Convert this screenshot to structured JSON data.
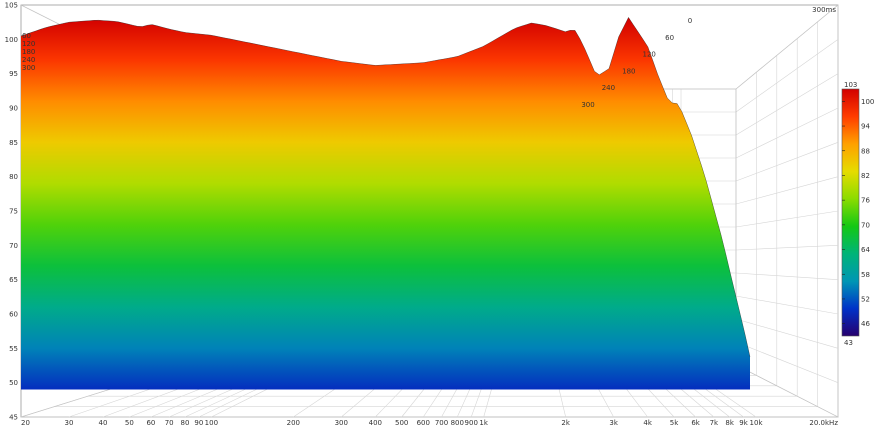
{
  "chart_data": {
    "type": "waterfall",
    "window_label": "300ms",
    "x_axis": {
      "scale": "log",
      "range": [
        20,
        20000
      ],
      "ticks": [
        {
          "v": 20,
          "label": "20"
        },
        {
          "v": 30,
          "label": "30"
        },
        {
          "v": 40,
          "label": "40"
        },
        {
          "v": 50,
          "label": "50"
        },
        {
          "v": 60,
          "label": "60"
        },
        {
          "v": 70,
          "label": "70"
        },
        {
          "v": 80,
          "label": "80"
        },
        {
          "v": 90,
          "label": "90"
        },
        {
          "v": 100,
          "label": "100"
        },
        {
          "v": 200,
          "label": "200"
        },
        {
          "v": 300,
          "label": "300"
        },
        {
          "v": 400,
          "label": "400"
        },
        {
          "v": 500,
          "label": "500"
        },
        {
          "v": 600,
          "label": "600"
        },
        {
          "v": 700,
          "label": "700"
        },
        {
          "v": 800,
          "label": "800"
        },
        {
          "v": 900,
          "label": "900"
        },
        {
          "v": 1000,
          "label": "1k"
        },
        {
          "v": 2000,
          "label": "2k"
        },
        {
          "v": 3000,
          "label": "3k"
        },
        {
          "v": 4000,
          "label": "4k"
        },
        {
          "v": 5000,
          "label": "5k"
        },
        {
          "v": 6000,
          "label": "6k"
        },
        {
          "v": 7000,
          "label": "7k"
        },
        {
          "v": 8000,
          "label": "8k"
        },
        {
          "v": 9000,
          "label": "9k"
        },
        {
          "v": 10000,
          "label": "10k"
        },
        {
          "v": 20000,
          "label": "20.0kHz"
        }
      ]
    },
    "y_axis": {
      "range": [
        45,
        105
      ],
      "ticks": [
        {
          "v": 45,
          "label": "45"
        },
        {
          "v": 50,
          "label": "50"
        },
        {
          "v": 55,
          "label": "55"
        },
        {
          "v": 60,
          "label": "60"
        },
        {
          "v": 65,
          "label": "65"
        },
        {
          "v": 70,
          "label": "70"
        },
        {
          "v": 75,
          "label": "75"
        },
        {
          "v": 80,
          "label": "80"
        },
        {
          "v": 85,
          "label": "85"
        },
        {
          "v": 90,
          "label": "90"
        },
        {
          "v": 95,
          "label": "95"
        },
        {
          "v": 100,
          "label": "100"
        },
        {
          "v": 105,
          "label": "105"
        }
      ]
    },
    "time_axis": {
      "unit": "ms",
      "range": [
        0,
        300
      ],
      "ticks": [
        {
          "v": 0,
          "label": "0"
        },
        {
          "v": 60,
          "label": "60"
        },
        {
          "v": 120,
          "label": "120"
        },
        {
          "v": 180,
          "label": "180"
        },
        {
          "v": 240,
          "label": "240"
        },
        {
          "v": 300,
          "label": "300"
        }
      ],
      "left_labels": [
        "60",
        "120",
        "180",
        "240",
        "300"
      ]
    },
    "colorbar": {
      "range": [
        43,
        103
      ],
      "top_label": "103",
      "bottom_label": "43",
      "ticks": [
        {
          "v": 100,
          "label": "100"
        },
        {
          "v": 94,
          "label": "94"
        },
        {
          "v": 88,
          "label": "88"
        },
        {
          "v": 82,
          "label": "82"
        },
        {
          "v": 76,
          "label": "76"
        },
        {
          "v": 70,
          "label": "70"
        },
        {
          "v": 64,
          "label": "64"
        },
        {
          "v": 58,
          "label": "58"
        },
        {
          "v": 52,
          "label": "52"
        },
        {
          "v": 46,
          "label": "46"
        }
      ],
      "colors": [
        "#26006e",
        "#0032c8",
        "#0096b4",
        "#00b478",
        "#14c814",
        "#8cdc00",
        "#e6dc00",
        "#ffa000",
        "#ff3c00",
        "#d20000"
      ]
    },
    "series": [
      {
        "name": "0",
        "freq": [
          20,
          25,
          30,
          38,
          45,
          55,
          60,
          70,
          80,
          100,
          150,
          200,
          300,
          400,
          600,
          800,
          1000,
          1300,
          1500,
          1700,
          2000,
          2150,
          2300,
          2600,
          2900,
          3100,
          3400,
          4000,
          4400,
          4800,
          5200,
          5800,
          6500,
          7500,
          8500,
          9000
        ],
        "spl": [
          100.5,
          101.8,
          102.5,
          102.8,
          102.6,
          101.8,
          102.2,
          101.5,
          101,
          100.6,
          99.2,
          98.2,
          96.8,
          96.2,
          96.6,
          97.5,
          99,
          101.6,
          102.4,
          102,
          101.1,
          101.5,
          99.5,
          94.6,
          95.8,
          100,
          103.2,
          99,
          94.4,
          90.8,
          90.6,
          86,
          80,
          71,
          62,
          58
        ]
      }
    ]
  }
}
